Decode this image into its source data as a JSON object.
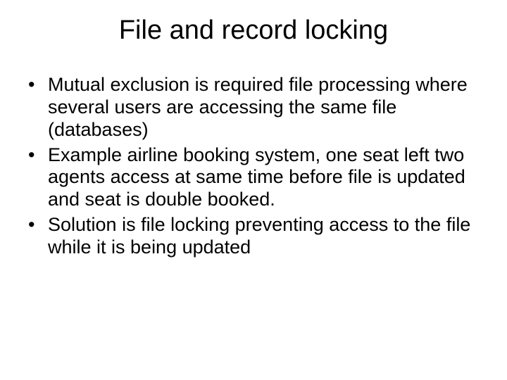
{
  "slide": {
    "title": "File and record locking",
    "bullets": [
      "Mutual exclusion is required file processing where several users are accessing the same file (databases)",
      "Example airline booking system, one seat left two agents access at same time before file is updated and seat is double booked.",
      "Solution is file locking preventing access to the file while it is being updated"
    ]
  }
}
